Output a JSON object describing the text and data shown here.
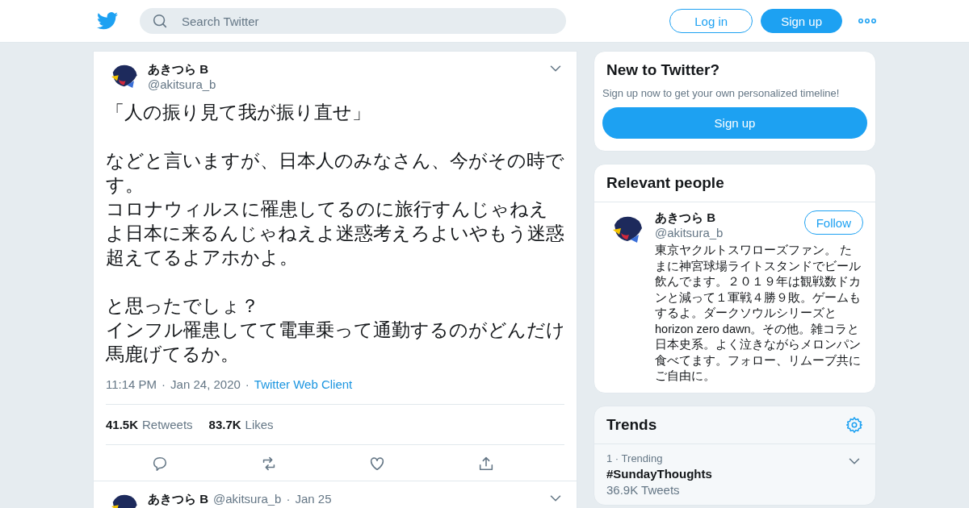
{
  "header": {
    "search": {
      "placeholder": "Search Twitter"
    },
    "login": "Log in",
    "signup": "Sign up"
  },
  "tweet": {
    "name": "あきつら B",
    "handle": "@akitsura_b",
    "paragraphs": [
      [
        "「人の振り見て我が振り直せ」"
      ],
      [
        "などと言いますが、日本人のみなさん、今がその時です。",
        "コロナウィルスに罹患してるのに旅行すんじゃねえよ日本に来るんじゃねえよ迷惑考えろよいやもう迷惑超えてるよアホかよ。"
      ],
      [
        "と思ったでしょ？",
        "インフル罹患してて電車乗って通勤するのがどんだけ馬鹿げてるか。"
      ]
    ],
    "separator": "·",
    "time": "11:14 PM",
    "date": "Jan 24, 2020",
    "client": "Twitter Web Client",
    "retweets": {
      "count": "41.5K",
      "label": "Retweets"
    },
    "likes": {
      "count": "83.7K",
      "label": "Likes"
    }
  },
  "next_tweet": {
    "name": "あきつら B",
    "handle": "@akitsura_b",
    "separator": "·",
    "date": "Jan 25"
  },
  "new_to_twitter": {
    "title": "New to Twitter?",
    "text": "Sign up now to get your own personalized timeline!",
    "button": "Sign up"
  },
  "relevant_people": {
    "title": "Relevant people",
    "person": {
      "name": "あきつら B",
      "handle": "@akitsura_b",
      "follow": "Follow",
      "bio": "東京ヤクルトスワローズファン。 たまに神宮球場ライトスタンドでビール飲んでます。２０１９年は観戦数ドカンと減って１軍戦４勝９敗。ゲームもするよ。ダークソウルシリーズとhorizon zero dawn。その他。雑コラと日本史系。よく泣きながらメロンパン食べてます。フォロー、リムーブ共にご自由に。"
    }
  },
  "trends": {
    "title": "Trends",
    "items": [
      {
        "rank": "1",
        "separator": "·",
        "context": "Trending",
        "tag": "#SundayThoughts",
        "count": "36.9K Tweets"
      }
    ]
  }
}
